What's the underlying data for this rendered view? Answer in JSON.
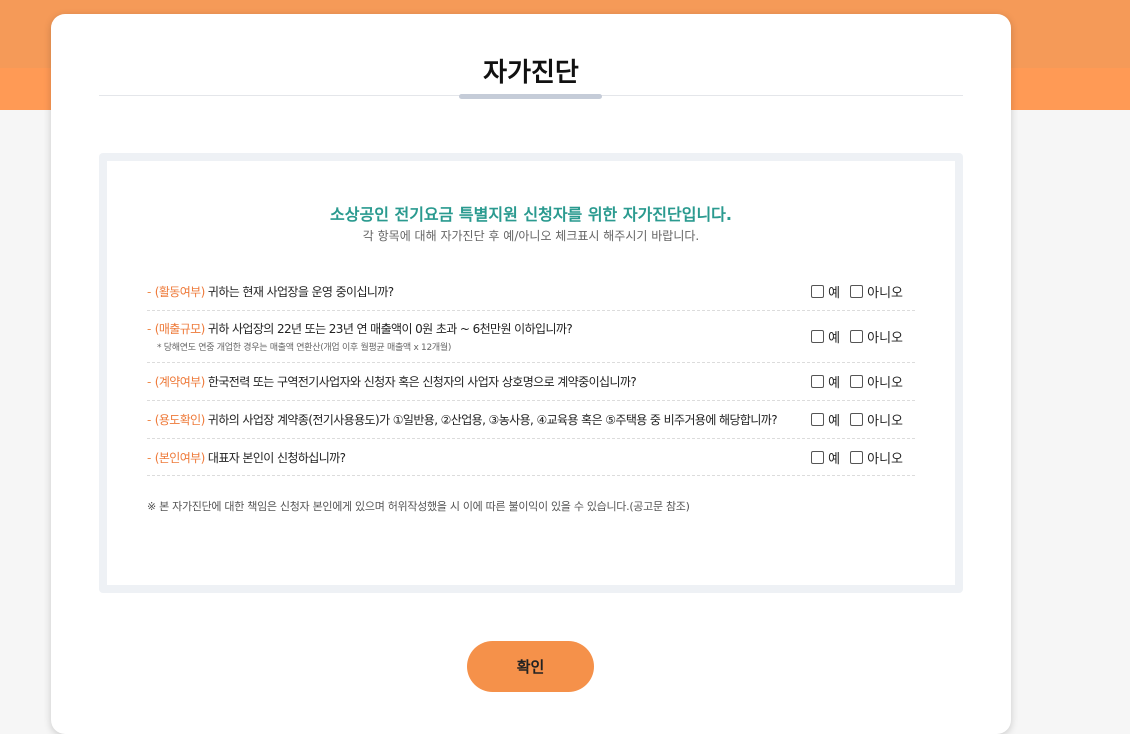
{
  "modal": {
    "title": "자가진단",
    "headline": "소상공인 전기요금 특별지원 신청자를 위한 자가진단입니다.",
    "subline": "각 항목에 대해 자가진단 후 예/아니오 체크표시 해주시기 바랍니다.",
    "dash": "-",
    "options": {
      "yes": "예",
      "no": "아니오"
    },
    "questions": [
      {
        "tag": "(활동여부)",
        "text": " 귀하는 현재 사업장을 운영 중이십니까?",
        "note": ""
      },
      {
        "tag": "(매출규모)",
        "text": " 귀하 사업장의 22년 또는 23년 연 매출액이 0원 초과 ~ 6천만원 이하입니까?",
        "note": "* 당해연도 연중 개업한 경우는 매출액 연환산(개업 이후 월평균 매출액 x 12개월)"
      },
      {
        "tag": "(계약여부)",
        "text": " 한국전력 또는 구역전기사업자와 신청자 혹은 신청자의 사업자 상호명으로 계약중이십니까?",
        "note": ""
      },
      {
        "tag": "(용도확인)",
        "text": " 귀하의 사업장 계약종(전기사용용도)가 ①일반용, ②산업용, ③농사용, ④교육용 혹은 ⑤주택용 중 비주거용에 해당합니까?",
        "note": ""
      },
      {
        "tag": "(본인여부)",
        "text": " 대표자 본인이 신청하십니까?",
        "note": ""
      }
    ],
    "footnote": "※ 본 자가진단에 대한 책임은 신청자 본인에게 있으며 허위작성했을 시 이에 따른 불이익이 있을 수 있습니다.(공고문 참조)",
    "confirm_label": "확인"
  },
  "colors": {
    "accent_orange": "#f5914a",
    "headline_teal": "#2a9a8f",
    "tag_orange": "#ee7a3a"
  }
}
